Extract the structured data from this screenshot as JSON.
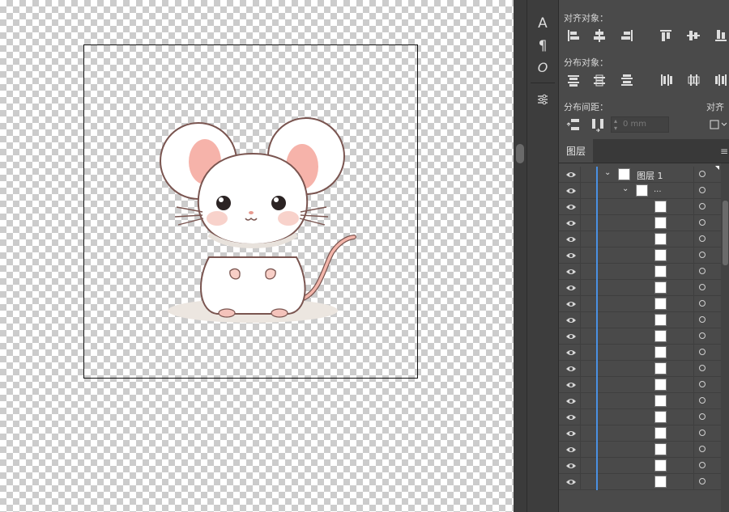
{
  "align_panel": {
    "align_objects_label": "对齐对象：",
    "distribute_objects_label": "分布对象：",
    "distribute_spacing_label": "分布间距：",
    "align_to_label": "对齐",
    "spacing_value": "0 mm"
  },
  "toolstrip": {
    "icons": [
      "character-icon",
      "paragraph-icon",
      "opentype-icon",
      "properties-icon"
    ],
    "glyphs": {
      "character": "A",
      "paragraph": "¶",
      "opentype": "O"
    }
  },
  "layers_panel": {
    "tab_label": "图层",
    "menu_glyph": "≡",
    "layer_name": "图层 1",
    "group_name": "...",
    "rows": 20,
    "accent_color": "#4a90e2"
  },
  "colors": {
    "panel_bg": "#4a4a4a",
    "dark_bg": "#3d3d3d",
    "mouse_ear_inner": "#f4a9a0",
    "mouse_outline": "#7a5550"
  }
}
